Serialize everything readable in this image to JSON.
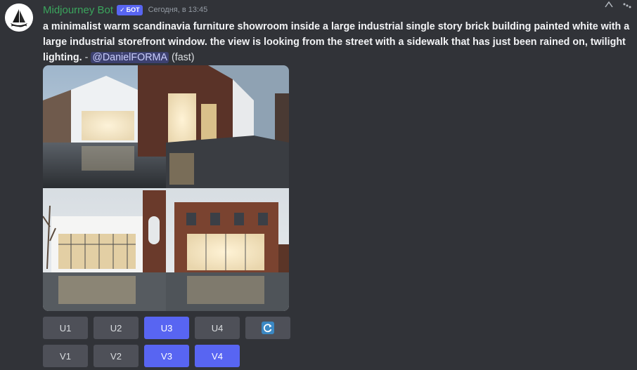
{
  "author": {
    "name": "Midjourney Bot",
    "badge_check": "✓",
    "badge": "БОТ",
    "timestamp": "Сегодня, в 13:45",
    "avatar_icon": "sailboat-logo-icon"
  },
  "message": {
    "prompt": "a minimalist warm scandinavia furniture showroom inside a large industrial single story brick building painted white with a large industrial storefront window. the view is looking from the street with a sidewalk that has just been rained on, twilight lighting.",
    "separator": " - ",
    "mention": "@DanielFORMA",
    "mode": " (fast)"
  },
  "image": {
    "description_icon": "generated-image-grid"
  },
  "buttons": {
    "row1": [
      {
        "label": "U1",
        "style": "secondary"
      },
      {
        "label": "U2",
        "style": "secondary"
      },
      {
        "label": "U3",
        "style": "primary"
      },
      {
        "label": "U4",
        "style": "secondary"
      }
    ],
    "reroll_icon": "refresh-icon",
    "row2": [
      {
        "label": "V1",
        "style": "secondary"
      },
      {
        "label": "V2",
        "style": "secondary"
      },
      {
        "label": "V3",
        "style": "primary"
      },
      {
        "label": "V4",
        "style": "primary"
      }
    ]
  },
  "colors": {
    "background": "#313338",
    "username": "#3ba55d",
    "blurple": "#5865f2",
    "button_secondary": "#4e5058"
  }
}
